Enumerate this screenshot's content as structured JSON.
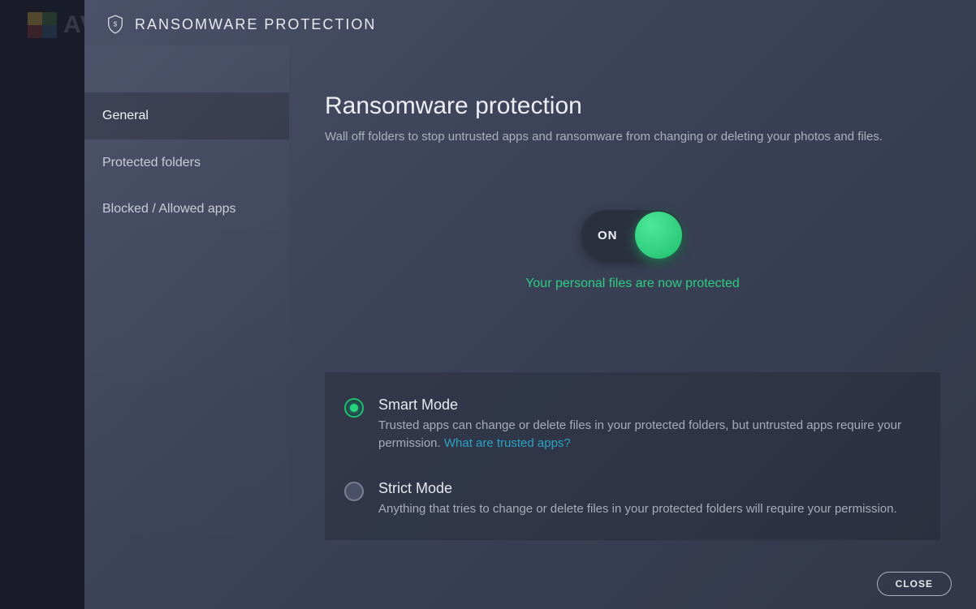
{
  "brand_text": "AV",
  "header": {
    "title": "RANSOMWARE PROTECTION"
  },
  "sidebar": {
    "items": [
      {
        "label": "General",
        "active": true
      },
      {
        "label": "Protected folders",
        "active": false
      },
      {
        "label": "Blocked / Allowed apps",
        "active": false
      }
    ]
  },
  "main": {
    "title": "Ransomware protection",
    "subtitle": "Wall off folders to stop untrusted apps and ransomware from changing or deleting your photos and files.",
    "toggle": {
      "state_label": "ON",
      "status_text": "Your personal files are now protected"
    },
    "modes": [
      {
        "title": "Smart Mode",
        "desc_pre": "Trusted apps can change or delete files in your protected folders, but untrusted apps require your permission.  ",
        "link": "What are trusted apps?",
        "selected": true
      },
      {
        "title": "Strict Mode",
        "desc_pre": "Anything that tries to change or delete files in your protected folders will require your permission.",
        "link": "",
        "selected": false
      }
    ]
  },
  "footer": {
    "close_label": "CLOSE"
  }
}
